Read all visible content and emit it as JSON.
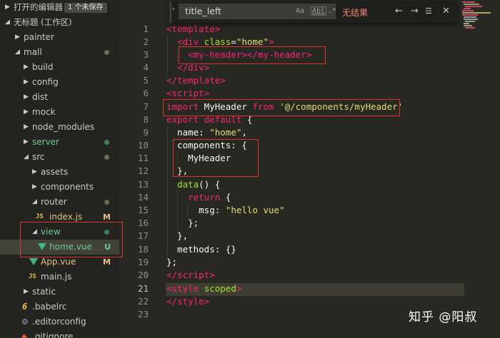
{
  "sidebar": {
    "open_editors_label": "打开的编辑器",
    "unsaved_badge": "1 个未保存",
    "workspace_label": "无标题 (工作区)",
    "items": [
      {
        "label": "painter",
        "badge": ""
      },
      {
        "label": "mall",
        "badge": "dot"
      },
      {
        "label": "build",
        "badge": ""
      },
      {
        "label": "config",
        "badge": ""
      },
      {
        "label": "dist",
        "badge": ""
      },
      {
        "label": "mock",
        "badge": ""
      },
      {
        "label": "node_modules",
        "badge": ""
      },
      {
        "label": "server",
        "badge": "dot"
      },
      {
        "label": "src",
        "badge": "dot"
      },
      {
        "label": "assets",
        "badge": ""
      },
      {
        "label": "components",
        "badge": ""
      },
      {
        "label": "router",
        "badge": "dot"
      },
      {
        "label": "index.js",
        "badge": "M",
        "icon": "JS"
      },
      {
        "label": "view",
        "badge": "dot"
      },
      {
        "label": "home.vue",
        "badge": "U"
      },
      {
        "label": "App.vue",
        "badge": "M"
      },
      {
        "label": "main.js",
        "badge": "",
        "icon": "JS"
      },
      {
        "label": "static",
        "badge": ""
      },
      {
        "label": ".babelrc",
        "badge": "",
        "icon": "6"
      },
      {
        "label": ".editorconfig",
        "badge": ""
      },
      {
        "label": ".gitignore",
        "badge": ""
      }
    ]
  },
  "find": {
    "query": "title_left",
    "opt_case": "Aa",
    "opt_word": "Abl",
    "opt_regex": ".*",
    "no_result": "无结果"
  },
  "editor": {
    "line_numbers": [
      "1",
      "2",
      "3",
      "4",
      "5",
      "6",
      "7",
      "8",
      "9",
      "10",
      "11",
      "12",
      "13",
      "14",
      "15",
      "16",
      "17",
      "18",
      "19",
      "20",
      "21",
      "22",
      "23"
    ],
    "current_line": 21
  },
  "colors": {
    "tag": "#f92672",
    "attr": "#a6e22e",
    "string": "#e6db74",
    "keyword2": "#66d9ef",
    "highlight_box": "#e0302f",
    "git_untracked": "#73c991",
    "git_modified": "#e2c08d"
  },
  "watermark": "知乎 @阳叔"
}
